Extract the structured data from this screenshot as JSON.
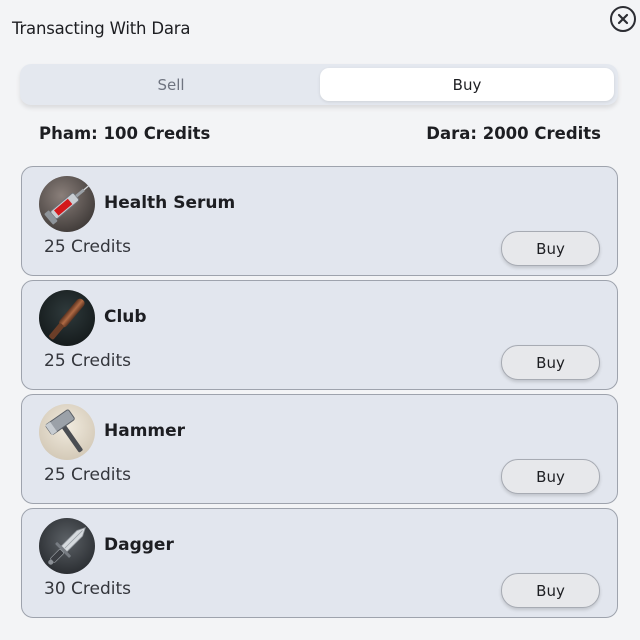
{
  "window": {
    "title": "Transacting With Dara",
    "close_icon": "close-icon"
  },
  "tabs": [
    {
      "label": "Sell",
      "active": false
    },
    {
      "label": "Buy",
      "active": true
    }
  ],
  "balances": {
    "player": "Pham: 100 Credits",
    "merchant": "Dara: 2000 Credits"
  },
  "items": [
    {
      "name": "Health Serum",
      "price": "25 Credits",
      "button": "Buy",
      "icon": "syringe-icon"
    },
    {
      "name": "Club",
      "price": "25 Credits",
      "button": "Buy",
      "icon": "club-icon"
    },
    {
      "name": "Hammer",
      "price": "25 Credits",
      "button": "Buy",
      "icon": "hammer-icon"
    },
    {
      "name": "Dagger",
      "price": "30 Credits",
      "button": "Buy",
      "icon": "dagger-icon"
    }
  ],
  "colors": {
    "background": "#f3f4f6",
    "card": "#e2e6ee",
    "active_tab": "#ffffff"
  }
}
